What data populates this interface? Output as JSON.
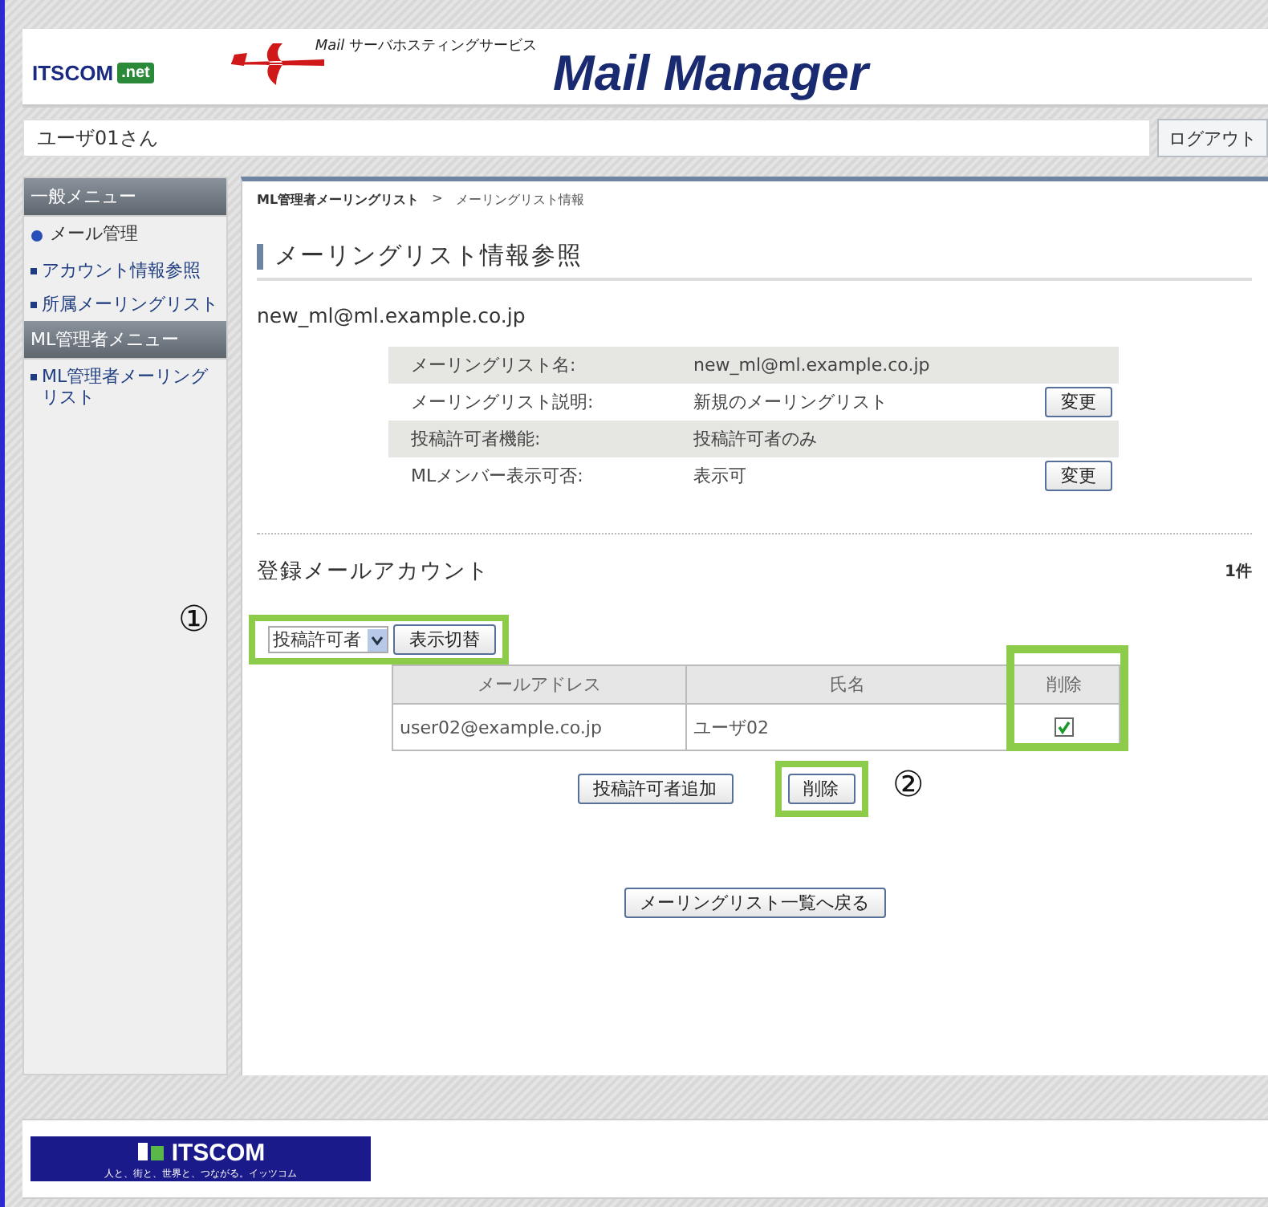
{
  "header": {
    "logo": "ITSCOM",
    "logo_suffix": ".net",
    "service": "*Mail* サーバホスティングサービス",
    "product": "Mail Manager"
  },
  "user_bar": {
    "user": "ユーザ01さん",
    "logout": "ログアウト"
  },
  "sidebar": {
    "sections": [
      {
        "title": "一般メニュー",
        "items": [
          {
            "label": "メール管理",
            "kind": "heading"
          },
          {
            "label": "アカウント情報参照",
            "kind": "link"
          },
          {
            "label": "所属メーリングリスト",
            "kind": "link"
          }
        ]
      },
      {
        "title": "ML管理者メニュー",
        "items": [
          {
            "label": "ML管理者メーリングリスト",
            "kind": "link"
          }
        ]
      }
    ]
  },
  "breadcrumb": {
    "items": [
      "ML管理者メーリングリスト",
      "メーリングリスト情報"
    ],
    "separator": ">"
  },
  "page_title": "メーリングリスト情報参照",
  "list_address": "new_ml@ml.example.co.jp",
  "info_rows": [
    {
      "label": "メーリングリスト名:",
      "value": "new_ml@ml.example.co.jp"
    },
    {
      "label": "メーリングリスト説明:",
      "value": "新規のメーリングリスト",
      "button": "変更"
    },
    {
      "label": "投稿許可者機能:",
      "value": "投稿許可者のみ"
    },
    {
      "label": "MLメンバー表示可否:",
      "value": "表示可",
      "button": "変更"
    }
  ],
  "accounts": {
    "title": "登録メールアカウント",
    "count": "1件",
    "filter": {
      "value": "投稿許可者",
      "button": "表示切替"
    },
    "columns": [
      "メールアドレス",
      "氏名",
      "削除"
    ],
    "rows": [
      {
        "address": "user02@example.co.jp",
        "name": "ユーザ02",
        "checked": true
      }
    ],
    "buttons": [
      "投稿許可者追加",
      "削除"
    ]
  },
  "back_button": "メーリングリスト一覧へ戻る",
  "annotations": [
    {
      "label": "①"
    },
    {
      "label": "②"
    }
  ],
  "footer": {
    "logo": "ITSCOM",
    "tagline": "人と、街と、世界と、つながる。イッツコム"
  }
}
